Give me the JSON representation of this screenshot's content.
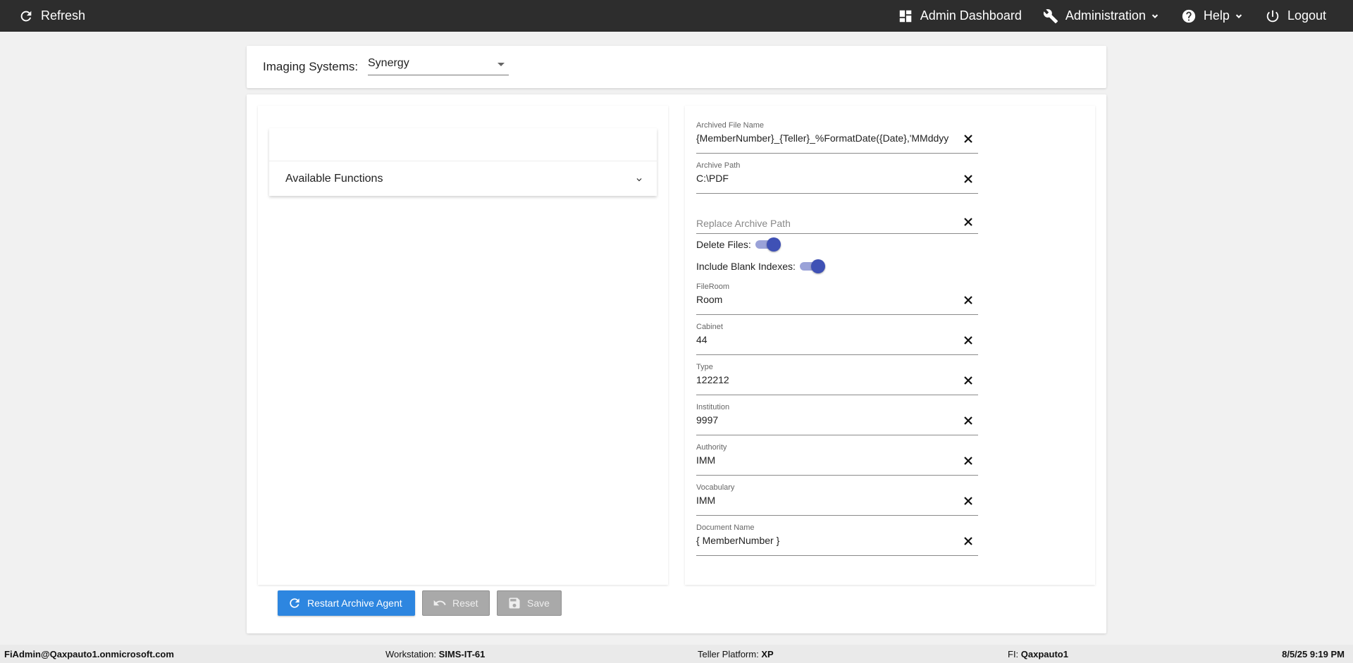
{
  "nav": {
    "refresh": "Refresh",
    "admin_dashboard": "Admin Dashboard",
    "administration": "Administration",
    "help": "Help",
    "logout": "Logout"
  },
  "imaging": {
    "label": "Imaging Systems:",
    "selected": "Synergy"
  },
  "functions": {
    "title": "Available Functions"
  },
  "form": {
    "archived_file_name": {
      "label": "Archived File Name",
      "value": "{MemberNumber}_{Teller}_%FormatDate({Date},'MMddyy"
    },
    "archive_path": {
      "label": "Archive Path",
      "value": "C:\\PDF"
    },
    "replace_archive_path": {
      "placeholder": "Replace Archive Path"
    },
    "delete_files": {
      "label": "Delete Files:"
    },
    "include_blank_indexes": {
      "label": "Include Blank Indexes:"
    },
    "fileroom": {
      "label": "FileRoom",
      "value": "Room"
    },
    "cabinet": {
      "label": "Cabinet",
      "value": "44"
    },
    "type": {
      "label": "Type",
      "value": "122212"
    },
    "institution": {
      "label": "Institution",
      "value": "9997"
    },
    "authority": {
      "label": "Authority",
      "value": "IMM"
    },
    "vocabulary": {
      "label": "Vocabulary",
      "value": "IMM"
    },
    "document_name": {
      "label": "Document Name",
      "value": "{ MemberNumber }"
    }
  },
  "buttons": {
    "restart": "Restart Archive Agent",
    "reset": "Reset",
    "save": "Save"
  },
  "status": {
    "user": "FiAdmin@Qaxpauto1.onmicrosoft.com",
    "workstation_label": "Workstation:",
    "workstation": "SIMS-IT-61",
    "teller_label": "Teller Platform:",
    "teller": "XP",
    "fi_label": "FI:",
    "fi": "Qaxpauto1",
    "datetime": "8/5/25 9:19 PM"
  },
  "colors": {
    "nav_bg": "#2d2d2d",
    "primary": "#2d86e0",
    "toggle": "#3f51b5"
  },
  "toggles": {
    "delete_files_on": true,
    "include_blank_indexes_on": true
  }
}
